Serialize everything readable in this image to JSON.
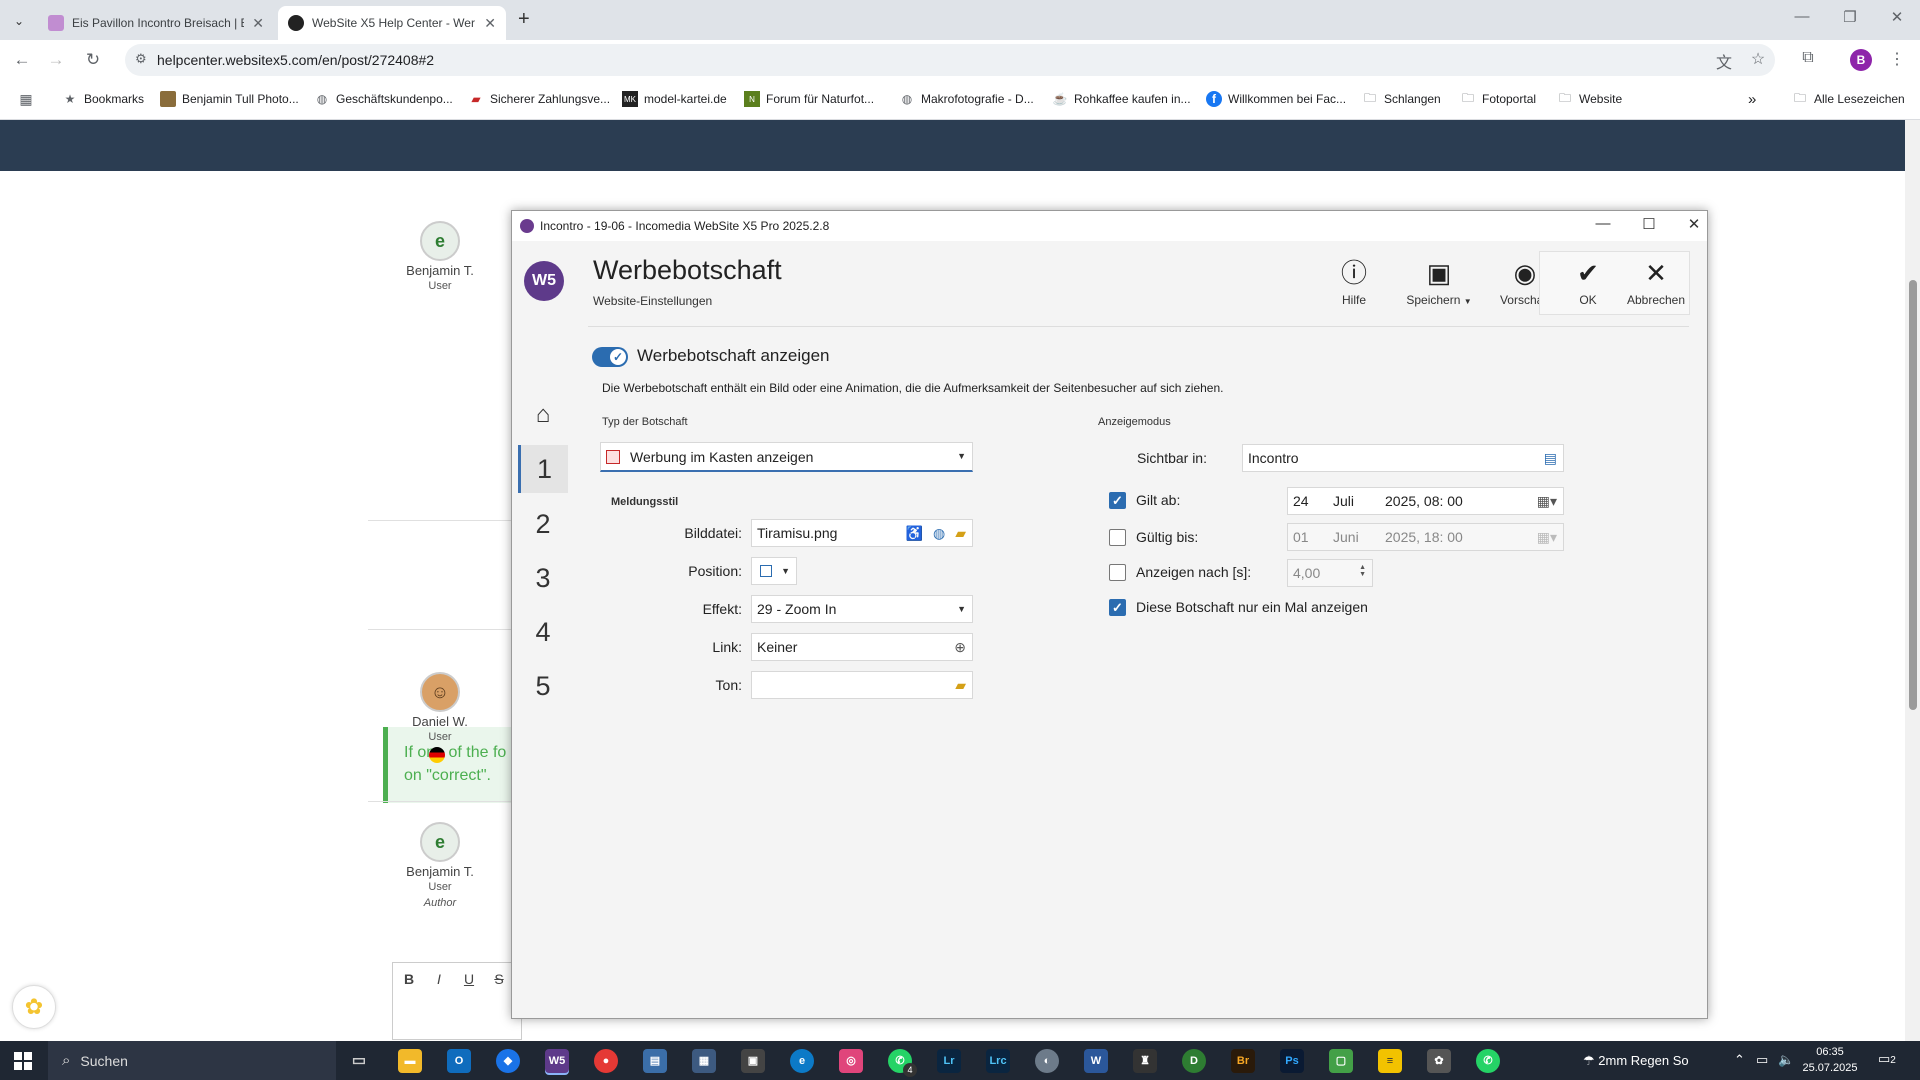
{
  "browser": {
    "tabs": [
      {
        "title": "Eis Pavillon Incontro Breisach | E",
        "active": false
      },
      {
        "title": "WebSite X5 Help Center - Wer",
        "active": true
      }
    ],
    "url": "helpcenter.websitex5.com/en/post/272408#2",
    "bookmarks": [
      {
        "label": "Bookmarks",
        "icon": "star-icon"
      },
      {
        "label": "Benjamin Tull Photo...",
        "icon": "photo-icon"
      },
      {
        "label": "Geschäftskundenpo...",
        "icon": "globe-icon"
      },
      {
        "label": "Sicherer Zahlungsve...",
        "icon": "payment-icon"
      },
      {
        "label": "model-kartei.de",
        "icon": "mk-icon"
      },
      {
        "label": "Forum für Naturfot...",
        "icon": "nf-icon"
      },
      {
        "label": "Makrofotografie - D...",
        "icon": "globe-icon"
      },
      {
        "label": "Rohkaffee kaufen in...",
        "icon": "coffee-icon"
      },
      {
        "label": "Willkommen bei Fac...",
        "icon": "facebook-icon"
      },
      {
        "label": "Schlangen",
        "icon": "folder-icon"
      },
      {
        "label": "Fotoportal",
        "icon": "folder-icon"
      },
      {
        "label": "Website",
        "icon": "folder-icon"
      }
    ],
    "all_bookmarks": "Alle Lesezeichen",
    "more": "»",
    "avatar_letter": "B"
  },
  "page": {
    "users": [
      {
        "name": "Benjamin T.",
        "role": "User",
        "extra": ""
      },
      {
        "name": "Daniel W.",
        "role": "User",
        "extra": ""
      },
      {
        "name": "Benjamin T.",
        "role": "User",
        "extra": "Author"
      }
    ],
    "callout": "If one of the fo on \"correct\"."
  },
  "dialog": {
    "window_title": "Incontro - 19-06 - Incomedia WebSite X5 Pro 2025.2.8",
    "logo": "W5",
    "heading": "Werbebotschaft",
    "subheading": "Website-Einstellungen",
    "tools": {
      "help": "Hilfe",
      "save": "Speichern",
      "preview": "Vorschau",
      "ok": "OK",
      "cancel": "Abbrechen"
    },
    "nav": [
      "1",
      "2",
      "3",
      "4",
      "5"
    ],
    "toggle_label": "Werbebotschaft anzeigen",
    "description": "Die Werbebotschaft enthält ein Bild oder eine Animation, die die Aufmerksamkeit der Seitenbesucher auf sich ziehen.",
    "type_section": "Typ der Botschaft",
    "type_value": "Werbung im Kasten anzeigen",
    "style_section": "Meldungsstil",
    "fields": {
      "image_label": "Bilddatei:",
      "image_value": "Tiramisu.png",
      "position_label": "Position:",
      "effect_label": "Effekt:",
      "effect_value": "29 - Zoom In",
      "link_label": "Link:",
      "link_value": "Keiner",
      "sound_label": "Ton:",
      "sound_value": ""
    },
    "mode_section": "Anzeigemodus",
    "visible_label": "Sichtbar in:",
    "visible_value": "Incontro",
    "valid_from": {
      "label": "Gilt ab:",
      "checked": true,
      "day": "24",
      "month": "Juli",
      "yeartime": "2025, 08: 00"
    },
    "valid_until": {
      "label": "Gültig bis:",
      "checked": false,
      "day": "01",
      "month": "Juni",
      "yeartime": "2025, 18: 00"
    },
    "show_after": {
      "label": "Anzeigen nach [s]:",
      "checked": false,
      "value": "4,00"
    },
    "once": {
      "label": "Diese Botschaft nur ein Mal anzeigen",
      "checked": true
    }
  },
  "taskbar": {
    "search": "Suchen",
    "weather": "2mm Regen So",
    "time": "06:35",
    "date": "25.07.2025",
    "notifications": "2",
    "whatsapp_badge": "4"
  },
  "colors": {
    "banner": "#2b3d52",
    "accent": "#2b6cb0",
    "callout_green": "#4caf50"
  }
}
